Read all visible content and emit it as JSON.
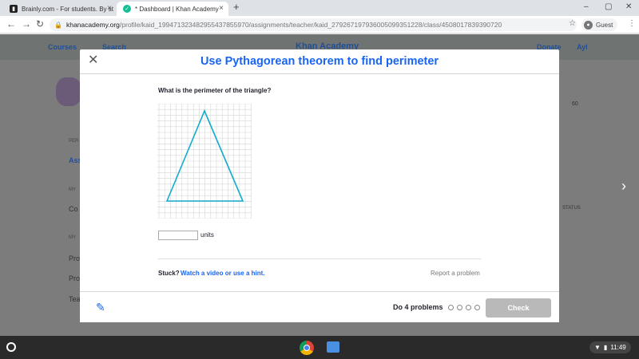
{
  "browser": {
    "tabs": [
      {
        "title": "Brainly.com - For students. By st",
        "icon": "brainly-icon",
        "active": false
      },
      {
        "title": "* Dashboard | Khan Academy",
        "icon": "khan-academy-icon",
        "active": true
      }
    ],
    "url_host": "khanacademy.org",
    "url_path": "/profile/kaid_199471323482955437855970/assignments/teacher/kaid_279267197936005099351228/class/4508017839390720",
    "profile_label": "Guest"
  },
  "background_page": {
    "courses": "Courses",
    "search": "Search",
    "logo": "Khan Academy",
    "donate": "Donate",
    "user": "Ayl",
    "points": "60",
    "status": "STATUS",
    "sidebar": [
      "PER",
      "Ass",
      "MY",
      "Co",
      "MY",
      "Pro",
      "Pro",
      "Tea"
    ]
  },
  "modal": {
    "title": "Use Pythagorean theorem to find perimeter",
    "question": "What is the perimeter of the triangle?",
    "answer_value": "",
    "units_label": "units",
    "stuck_label": "Stuck?",
    "hint_label": "Watch a video or use a hint.",
    "report_label": "Report a problem",
    "do_problems": "Do 4 problems",
    "progress_total": 4,
    "progress_done": 0,
    "check_label": "Check",
    "triangle_color": "#11accd",
    "accent_color": "#1865f2"
  },
  "taskbar": {
    "time": "11:49"
  }
}
